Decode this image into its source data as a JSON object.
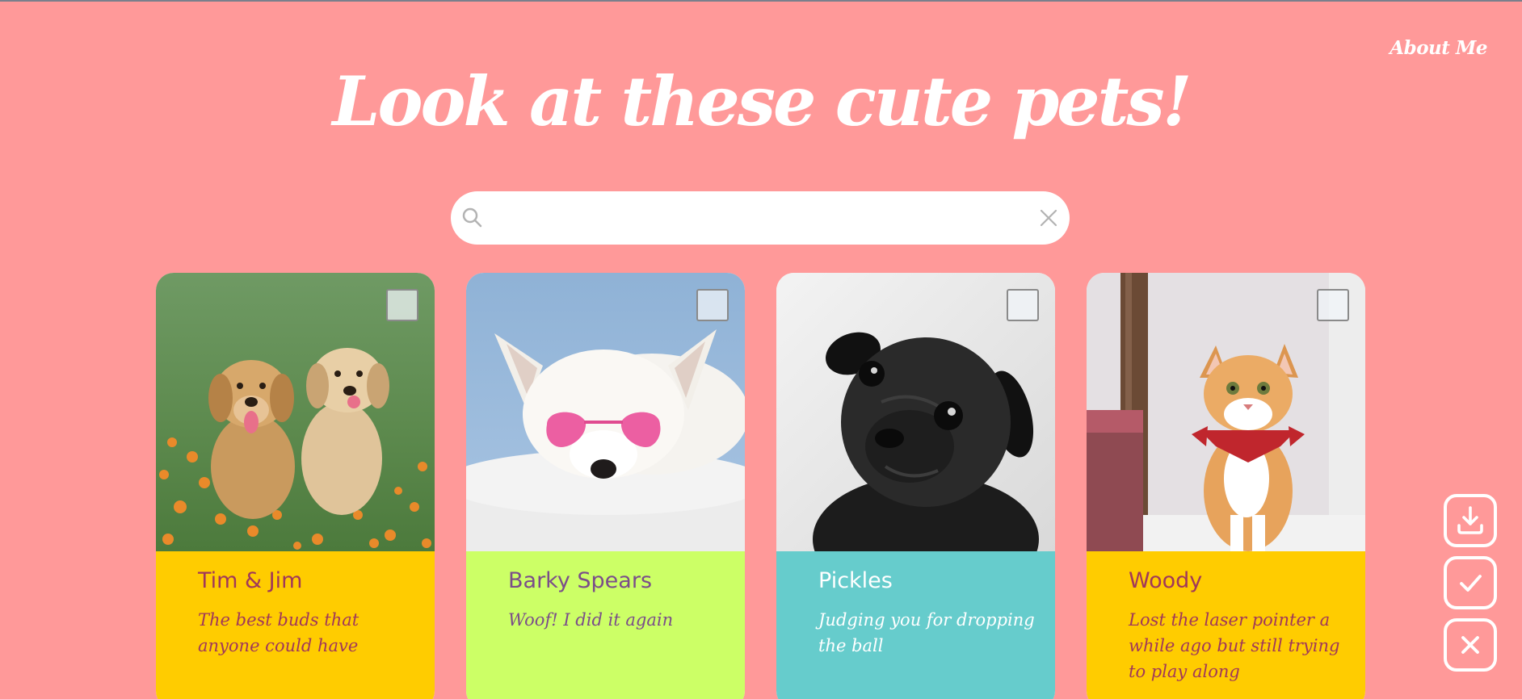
{
  "nav": {
    "about_label": "About Me"
  },
  "header": {
    "title": "Look at these cute pets!"
  },
  "search": {
    "value": "",
    "placeholder": ""
  },
  "colors": {
    "background": "#ff9999",
    "card_yellow": "#ffcc00",
    "card_lime": "#ccff66",
    "card_teal": "#66cccc",
    "text_maroon": "#a0385a",
    "text_purple": "#7a4d8a",
    "text_white": "#ffffff"
  },
  "pets": [
    {
      "name": "Tim & Jim",
      "description": "The best buds that anyone could have",
      "photo": "two-golden-retriever-puppies-photo"
    },
    {
      "name": "Barky Spears",
      "description": "Woof! I did it again",
      "photo": "white-dog-heart-sunglasses-photo"
    },
    {
      "name": "Pickles",
      "description": "Judging you for dropping the ball",
      "photo": "black-pug-photo"
    },
    {
      "name": "Woody",
      "description": "Lost the laser pointer a while ago but still trying to play along",
      "photo": "orange-tabby-cat-bandana-photo"
    }
  ],
  "actions": {
    "download_icon": "download-icon",
    "select_all_icon": "check-icon",
    "clear_icon": "close-icon"
  }
}
